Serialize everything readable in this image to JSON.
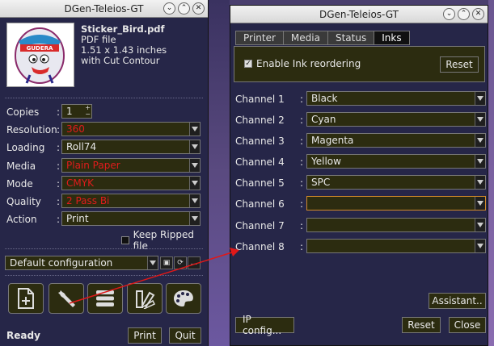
{
  "left_window": {
    "title": "DGen-Teleios-GT",
    "file": {
      "name": "Sticker_Bird.pdf",
      "type": "PDF file",
      "size": "1.51 x 1.43 inches",
      "note": "with Cut Contour"
    },
    "thumbnail_text": "GUDERA",
    "fields": [
      {
        "label": "Copies",
        "value": "1"
      },
      {
        "label": "Resolution",
        "value": "360"
      },
      {
        "label": "Loading",
        "value": "Roll74"
      },
      {
        "label": "Media",
        "value": "Plain Paper"
      },
      {
        "label": "Mode",
        "value": "CMYK"
      },
      {
        "label": "Quality",
        "value": "2 Pass Bi"
      },
      {
        "label": "Action",
        "value": "Print"
      }
    ],
    "keep_ripped_label": "Keep Ripped file",
    "configuration": "Default configuration",
    "status": "Ready",
    "print_label": "Print",
    "quit_label": "Quit",
    "more_label": "..."
  },
  "right_window": {
    "title": "DGen-Teleios-GT",
    "tabs": [
      "Printer",
      "Media",
      "Status",
      "Inks"
    ],
    "active_tab": "Inks",
    "enable_reordering_label": "Enable Ink reordering",
    "reset_top_label": "Reset",
    "channels": [
      {
        "label": "Channel 1",
        "value": "Black"
      },
      {
        "label": "Channel 2",
        "value": "Cyan"
      },
      {
        "label": "Channel 3",
        "value": "Magenta"
      },
      {
        "label": "Channel 4",
        "value": "Yellow"
      },
      {
        "label": "Channel 5",
        "value": "SPC"
      },
      {
        "label": "Channel 6",
        "value": ""
      },
      {
        "label": "Channel 7",
        "value": ""
      },
      {
        "label": "Channel 8",
        "value": ""
      }
    ],
    "assistant_label": "Assistant..",
    "ip_config_label": "IP config...",
    "reset_label": "Reset",
    "close_label": "Close"
  }
}
